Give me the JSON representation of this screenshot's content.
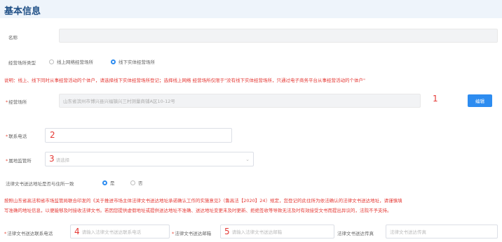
{
  "header": {
    "title": "基本信息"
  },
  "fields": {
    "name": {
      "label": "名称",
      "value": ""
    },
    "site_type": {
      "label": "经营场所类型",
      "options": [
        "线上网络经营场所",
        "线下实体经营场所"
      ],
      "selected": "线下实体经营场所"
    },
    "notice1": "说明：线上、线下同时从事经营活动的个体户，请选择线下实体经营场所登记；选择线上网络 经营场所仅限于\"没有线下实体经营场所，只通过电子商务平台从事经营活动的个体户\"",
    "address": {
      "label": "经营场所",
      "value": "山东省滨州市博兴县兴福镇兴三村测量商铺A区10-12号",
      "edit_label": "编辑"
    },
    "phone": {
      "label": "联系电话",
      "value": ""
    },
    "authority": {
      "label": "属地监管所",
      "placeholder": "请选择"
    },
    "same_address": {
      "label": "法律文书送达地址是否与住所一致",
      "options": [
        "是",
        "否"
      ],
      "selected": "是"
    },
    "notice2_line1": "按照山东省高法和省市场监管局联合印发的《关于推进市场主体法律文书送达地址承诺确认工作的实施意见》（鲁高法【2020】24）规定，您登记的此住所为依法确认的法律文书送达地址，请谨慎填",
    "notice2_line2": "写准确的地址信息，以便能够及时接收法律文书。若因您提供虚假地址或提供送达地址不准确、送达地址变更未及时更新、拒绝签收等导致无法及时有效接受文书而提出异议的，法院不予支持。",
    "legal_phone": {
      "label": "法律文书送达联系电话",
      "placeholder": "请输入法律文书送达联系电话"
    },
    "legal_email": {
      "label": "法律文书送达邮箱",
      "placeholder": "请输入法律文书送达邮箱"
    },
    "legal_fax": {
      "label": "法律文书送达传真",
      "placeholder": "法律文书送达传真"
    }
  },
  "annotations": {
    "n1": "1",
    "n2": "2",
    "n3": "3",
    "n4": "4",
    "n5": "5"
  },
  "colors": {
    "accent": "#2d8cf0",
    "warning": "#e53935",
    "header_bg": "#eef4fb"
  }
}
